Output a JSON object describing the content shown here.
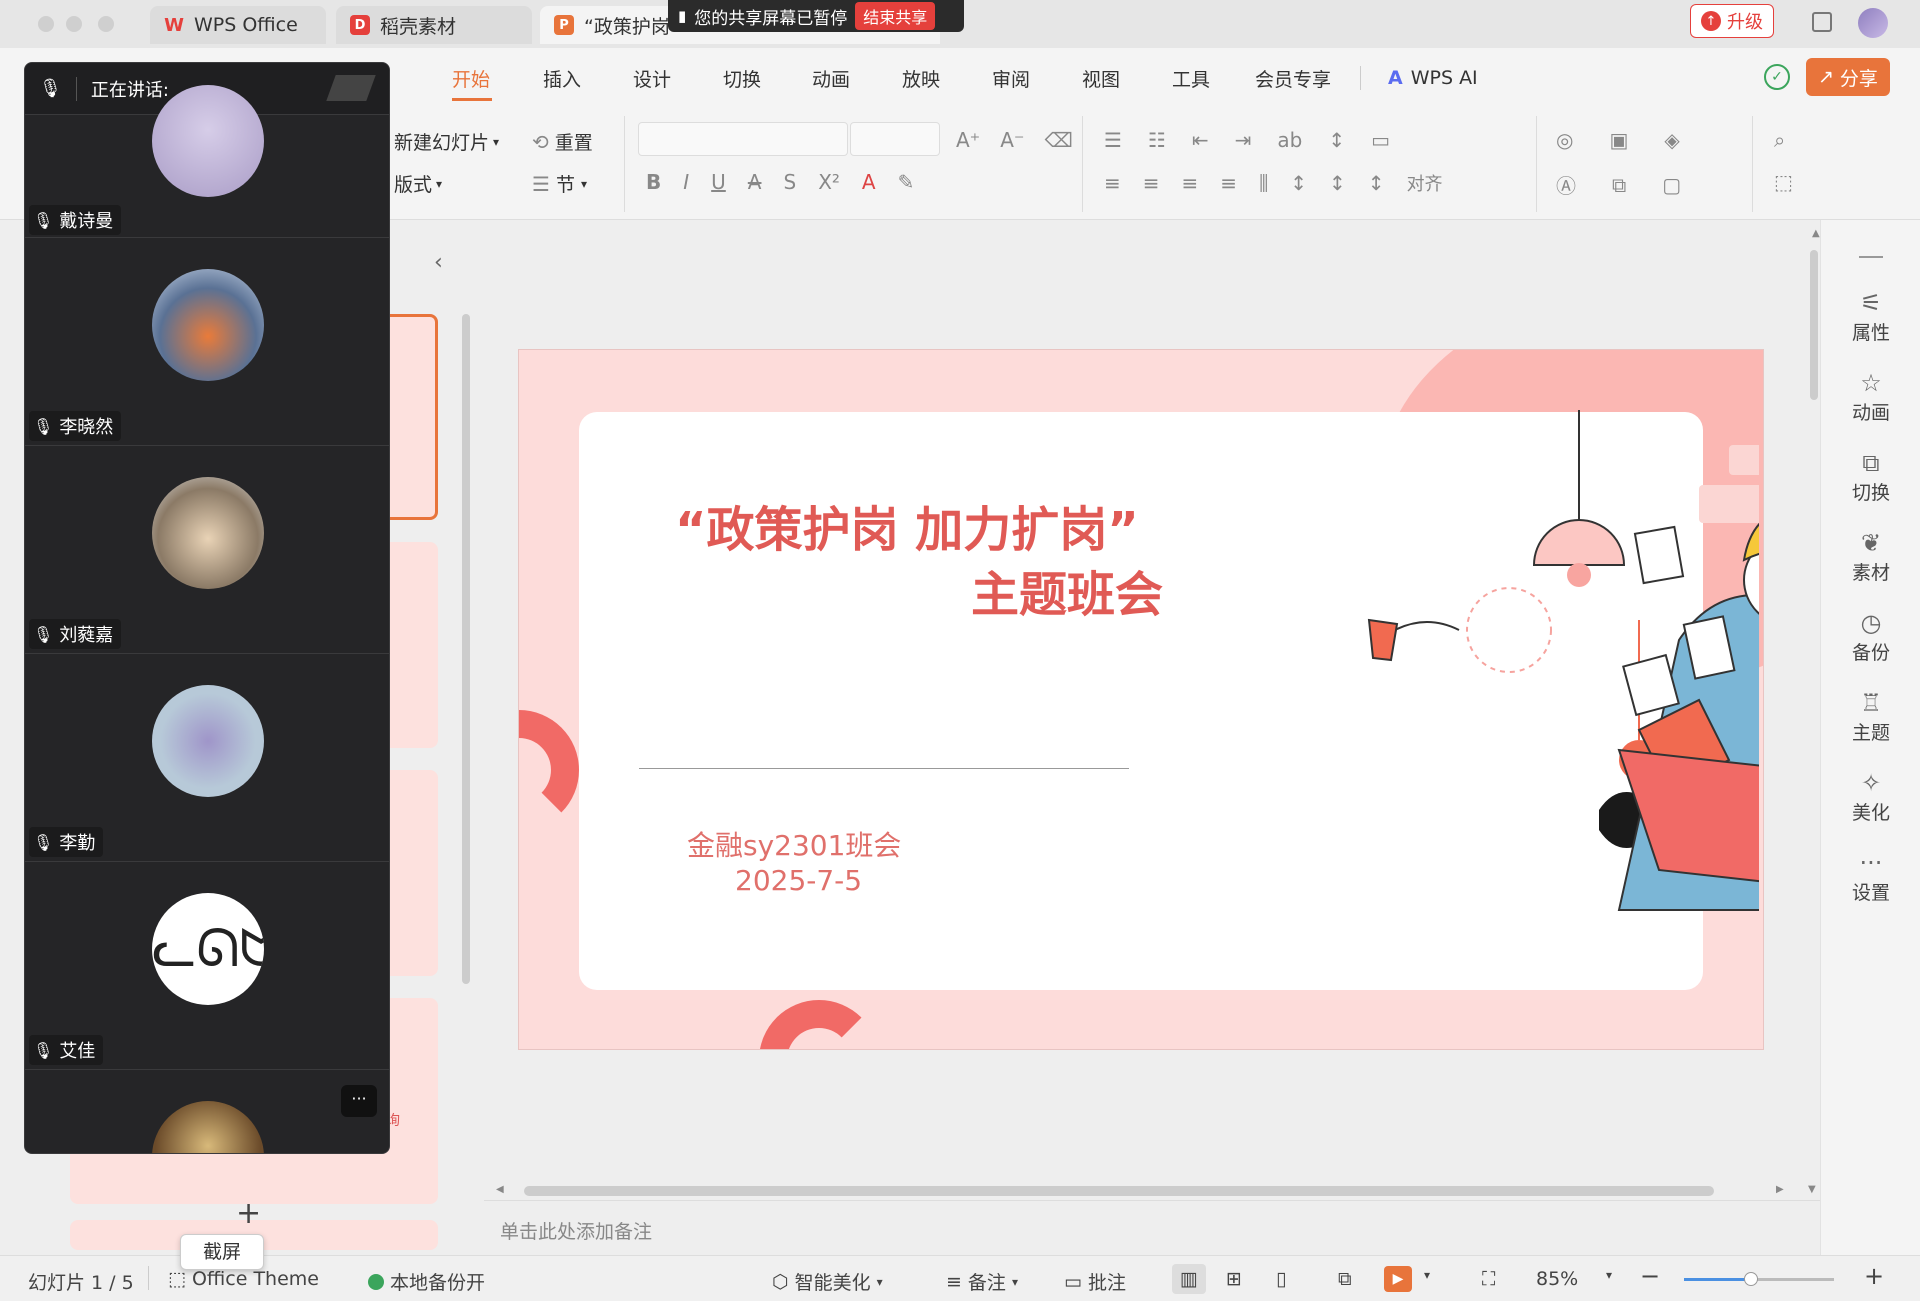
{
  "window": {
    "tabs": [
      {
        "label": "WPS Office",
        "icon": "wps-logo-icon"
      },
      {
        "label": "稻壳素材",
        "icon": "docer-icon"
      },
      {
        "label": "“政策护岗",
        "icon": "presentation-icon"
      }
    ],
    "upgrade_label": "升级",
    "share_label": "分享"
  },
  "share_notice": {
    "text": "您的共享屏幕已暂停",
    "end_label": "结束共享"
  },
  "menu": {
    "items": [
      "开始",
      "插入",
      "设计",
      "切换",
      "动画",
      "放映",
      "审阅",
      "视图",
      "工具",
      "会员专享"
    ],
    "active": "开始",
    "ai_label": "WPS AI"
  },
  "ribbon": {
    "new_slide": "新建幻灯片",
    "layout": "版式",
    "reset": "重置",
    "section": "节",
    "align": "对齐"
  },
  "meeting_panel": {
    "speaking_label": "正在讲话:",
    "participants": [
      {
        "name": "戴诗曼"
      },
      {
        "name": "李晓然"
      },
      {
        "name": "刘蕤嘉"
      },
      {
        "name": "李勤"
      },
      {
        "name": "艾佳"
      },
      {
        "name": ""
      }
    ]
  },
  "slide": {
    "title_line1": "“政策护岗 加力扩岗”",
    "title_line2": "主题班会",
    "class_name": "金融sy2301班会",
    "date": "2025-7-5"
  },
  "notes_placeholder": "单击此处添加备注",
  "thumb_peek_text": "询",
  "add_slide": "+",
  "screenshot_label": "截屏",
  "sidebar": [
    "属性",
    "动画",
    "切换",
    "素材",
    "备份",
    "主题",
    "美化",
    "设置"
  ],
  "status": {
    "slide_counter": "幻灯片 1 / 5",
    "theme": "Office Theme",
    "backup": "本地备份开",
    "beautify": "智能美化",
    "notes": "备注",
    "comments": "批注",
    "zoom": "85%"
  },
  "colors": {
    "accent": "#e8743b",
    "slide_red": "#e05a55",
    "slide_pink": "#fddcda"
  }
}
